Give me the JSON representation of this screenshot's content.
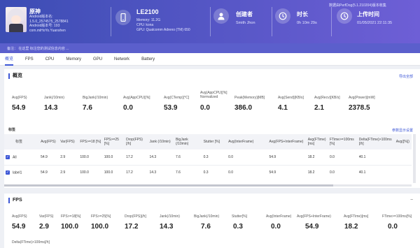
{
  "header": {
    "app_name": "原神",
    "app_meta": [
      "Android版本名:",
      "1.5.0_2574575_2578841",
      "Android版本号: 193",
      "com.miHoYo.Yuanshen"
    ],
    "device_name": "LE2100",
    "device_meta": [
      "Memory: 11.2G",
      "CPU: kona",
      "GPU: Qualcomm Adreno (TM) 650"
    ],
    "creator_label": "创建者",
    "creator_value": "Smith Jhon",
    "duration_label": "时长",
    "duration_value": "0h 10m 29s",
    "upload_label": "上传时间",
    "upload_value": "01/05/2021 22:11:35",
    "version_text": "数据由PerfDog(5.1.210204)版本收集",
    "remark_text": "备注：         在这里  标注您的测试信息内容 ...",
    "accent": "#3d57d6"
  },
  "tabs": [
    "概览",
    "FPS",
    "CPU",
    "Memory",
    "GPU",
    "Network",
    "Battery"
  ],
  "overview": {
    "title": "概览",
    "export_label": "导出全部",
    "metrics": [
      {
        "label": "Avg(FPS)",
        "value": "54.9"
      },
      {
        "label": "Jank(/10min)",
        "value": "14.3"
      },
      {
        "label": "BigJank(/10min)",
        "value": "7.6"
      },
      {
        "label": "Avg(AppCPU)[%]",
        "value": "0.0"
      },
      {
        "label": "Avg(CTemp)[°C]",
        "value": "53.9"
      },
      {
        "label": "Avg(AppCPU)[%] Normalized",
        "value": "0.0"
      },
      {
        "label": "Peak(Memory)[MB]",
        "value": "386.0"
      },
      {
        "label": "Avg(Send)[KB/s]",
        "value": "4.1"
      },
      {
        "label": "Avg(Recv)[KB/s]",
        "value": "2.1"
      },
      {
        "label": "Avg(Power)[mW]",
        "value": "2378.5"
      }
    ]
  },
  "labels_section": {
    "title": "标签",
    "settings_label": "参数显示设置",
    "columns": [
      "标签",
      "Avg(FPS)",
      "Var(FPS)",
      "FPS>=18 [%]",
      "FPS>=25 [%]",
      "Drop(FPS) [/h]",
      "Jank (/10min)",
      "BigJank (/10min)",
      "Stutter [%]",
      "Avg(InterFrame)",
      "Avg(FPS+InterFrame)",
      "Avg(FTime) [ms]",
      "FTime>=100ms [%]",
      "Delta(FTime)>100ms [/h]",
      "Avg([%])"
    ],
    "rows": [
      [
        "All",
        "54.9",
        "2.9",
        "100.0",
        "100.0",
        "17.2",
        "14.3",
        "7.6",
        "0.3",
        "0.0",
        "54.9",
        "18.2",
        "0.0",
        "40.1",
        ""
      ],
      [
        "label1",
        "54.9",
        "2.9",
        "100.0",
        "100.0",
        "17.2",
        "14.3",
        "7.6",
        "0.3",
        "0.0",
        "54.9",
        "18.2",
        "0.0",
        "40.1",
        ""
      ]
    ]
  },
  "fps_section": {
    "title": "FPS",
    "metrics": [
      {
        "label": "Avg(FPS)",
        "value": "54.9"
      },
      {
        "label": "Var(FPS)",
        "value": "2.9"
      },
      {
        "label": "FPS>=18[%]",
        "value": "100.0"
      },
      {
        "label": "FPS>=25[%]",
        "value": "100.0"
      },
      {
        "label": "Drop(FPS)[/h]",
        "value": "17.2"
      },
      {
        "label": "Jank(/10min)",
        "value": "14.3"
      },
      {
        "label": "BigJank(/10min)",
        "value": "7.6"
      },
      {
        "label": "Stutter[%]",
        "value": "0.3"
      },
      {
        "label": "Avg(InterFrame)",
        "value": "0.0"
      },
      {
        "label": "Avg(FPS+InterFrame)",
        "value": "54.9"
      },
      {
        "label": "Avg(FTime)[ms]",
        "value": "18.2"
      },
      {
        "label": "FTime>=100ms[%]",
        "value": "0.0"
      }
    ],
    "footer_label": "Delta(FTime)>100ms[/h]"
  }
}
